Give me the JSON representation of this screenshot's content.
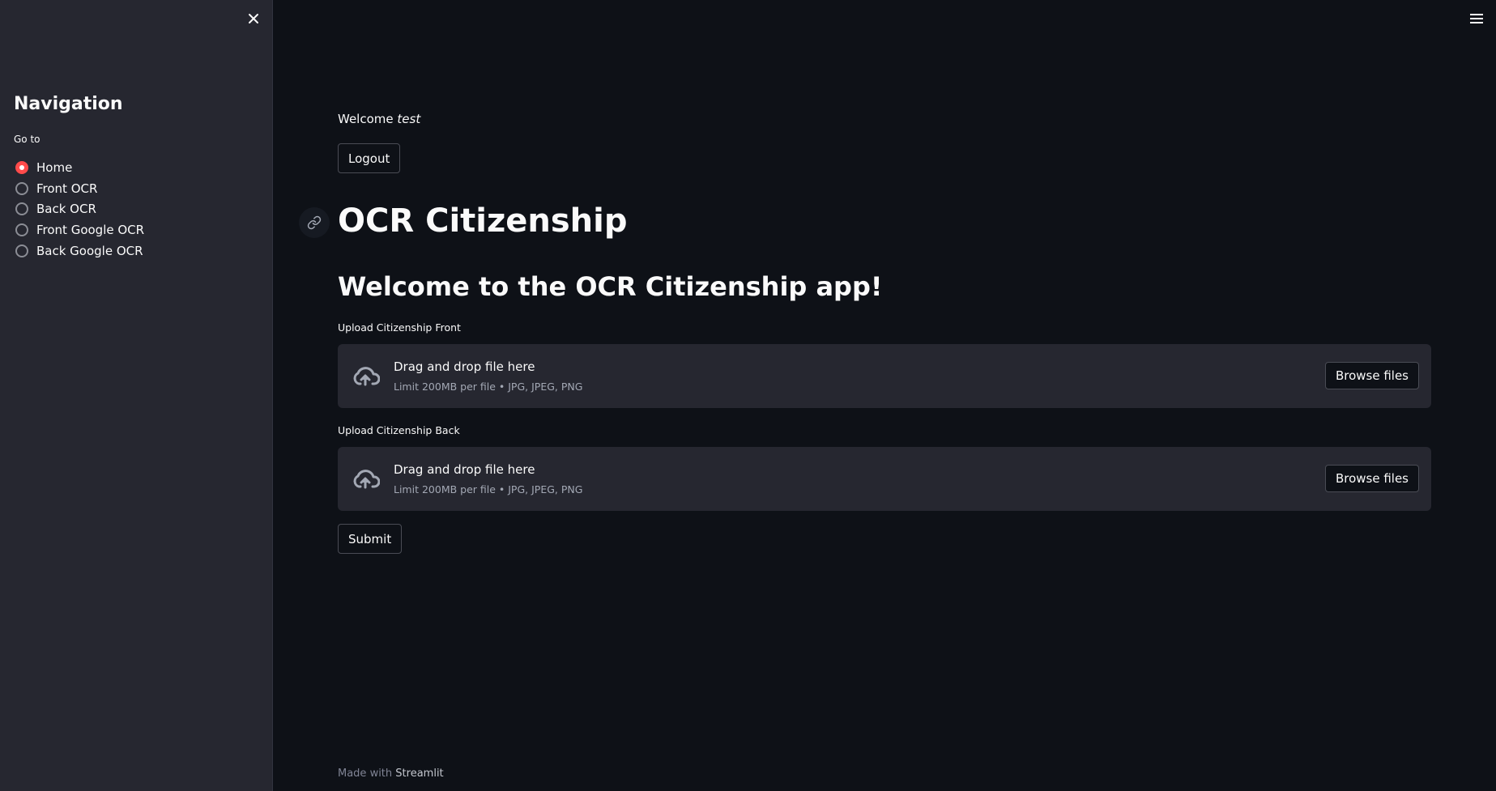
{
  "sidebar": {
    "title": "Navigation",
    "goto_label": "Go to",
    "items": [
      {
        "label": "Home",
        "selected": true
      },
      {
        "label": "Front OCR",
        "selected": false
      },
      {
        "label": "Back OCR",
        "selected": false
      },
      {
        "label": "Front Google OCR",
        "selected": false
      },
      {
        "label": "Back Google OCR",
        "selected": false
      }
    ],
    "close_icon": "close-icon"
  },
  "header": {
    "menu_icon": "hamburger-menu-icon"
  },
  "main": {
    "welcome_prefix": "Welcome",
    "welcome_user": "test",
    "logout_label": "Logout",
    "title": "OCR Citizenship",
    "subheading": "Welcome to the OCR Citizenship app!",
    "uploaders": [
      {
        "label": "Upload Citizenship Front",
        "drop_text": "Drag and drop file here",
        "limit_text": "Limit 200MB per file • JPG, JPEG, PNG",
        "browse_label": "Browse files"
      },
      {
        "label": "Upload Citizenship Back",
        "drop_text": "Drag and drop file here",
        "limit_text": "Limit 200MB per file • JPG, JPEG, PNG",
        "browse_label": "Browse files"
      }
    ],
    "submit_label": "Submit"
  },
  "footer": {
    "prefix": "Made with",
    "brand": "Streamlit"
  },
  "colors": {
    "background": "#0e1117",
    "sidebar": "#262730",
    "accent": "#ff4b4b"
  }
}
